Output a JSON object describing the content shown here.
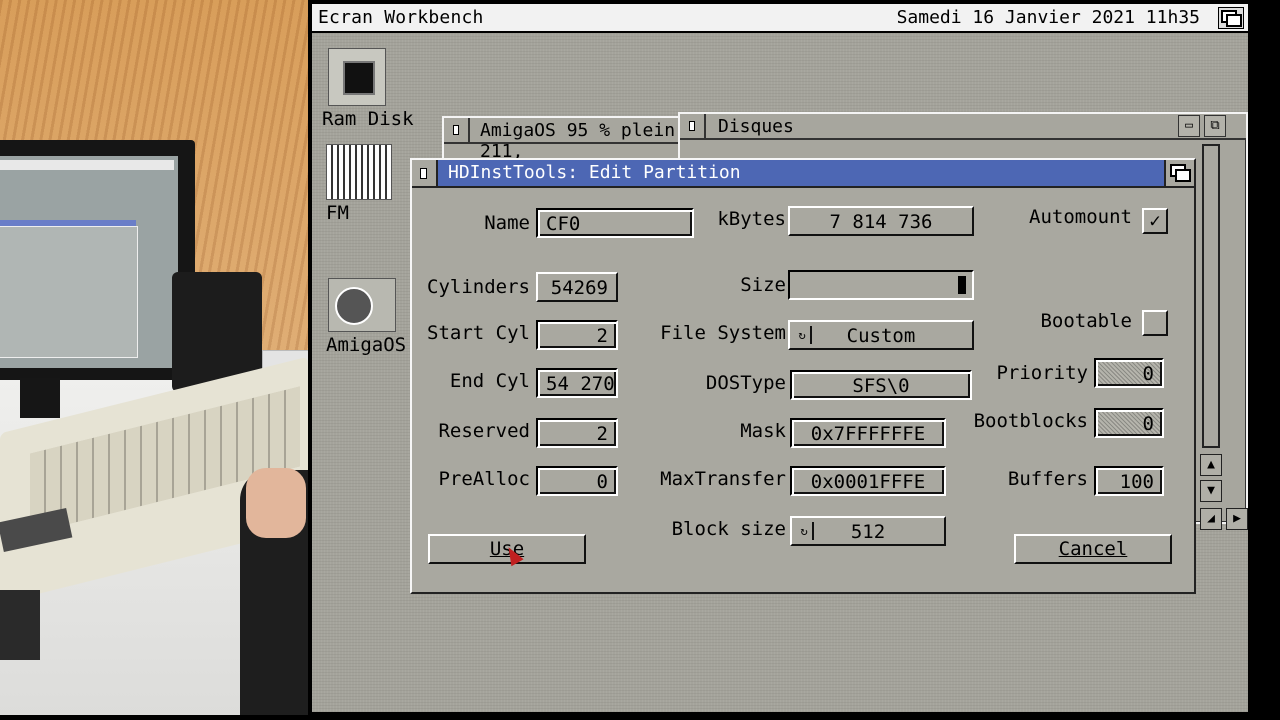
{
  "screen": {
    "title": "Ecran Workbench",
    "clock": "Samedi 16 Janvier 2021 11h35"
  },
  "icons": [
    {
      "name": "ram-disk-icon",
      "label": "Ram Disk"
    },
    {
      "name": "fm-icon",
      "label": "FM"
    },
    {
      "name": "amigaos-disk-icon",
      "label": "AmigaOS"
    }
  ],
  "windows": {
    "amigaos_title": "AmigaOS  95 % plein, 211,",
    "disques_title": "Disques"
  },
  "dialog": {
    "title": "HDInstTools: Edit Partition",
    "name_label": "Name",
    "name_value": "CF0",
    "kbytes_label": "kBytes",
    "kbytes_value": "7 814 736",
    "automount_label": "Automount",
    "automount_checked": "✓",
    "cylinders_label": "Cylinders",
    "cylinders_value": "54269",
    "size_label": "Size",
    "size_fill": 1.0,
    "start_cyl_label": "Start Cyl",
    "start_cyl_value": "2",
    "filesystem_label": "File System",
    "filesystem_value": "Custom",
    "bootable_label": "Bootable",
    "bootable_checked": "",
    "end_cyl_label": "End Cyl",
    "end_cyl_value": "54 270",
    "dostype_label": "DOSType",
    "dostype_value": "SFS\\0",
    "priority_label": "Priority",
    "priority_value": "0",
    "reserved_label": "Reserved",
    "reserved_value": "2",
    "mask_label": "Mask",
    "mask_value": "0x7FFFFFFE",
    "bootblocks_label": "Bootblocks",
    "bootblocks_value": "0",
    "prealloc_label": "PreAlloc",
    "prealloc_value": "0",
    "maxtransfer_label": "MaxTransfer",
    "maxtransfer_value": "0x0001FFFE",
    "buffers_label": "Buffers",
    "buffers_value": "100",
    "blocksize_label": "Block size",
    "blocksize_value": "512",
    "use_label": "Use",
    "cancel_label": "Cancel"
  },
  "colors": {
    "workbench_bg": "#a4a39b",
    "title_active": "#4d67b4",
    "pointer": "#c02020"
  }
}
